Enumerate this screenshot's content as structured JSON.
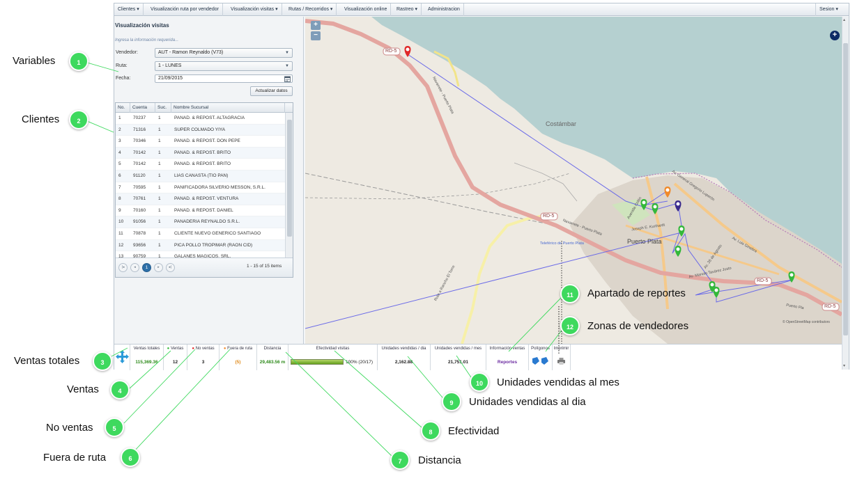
{
  "menu": {
    "items": [
      {
        "label": "Clientes",
        "caret": "▾"
      },
      {
        "label": "Visualización ruta por vendedor",
        "caret": ""
      },
      {
        "label": "Visualización visitas",
        "caret": "▾"
      },
      {
        "label": "Rutas / Recorridos",
        "caret": "▾"
      },
      {
        "label": "Visualización online",
        "caret": ""
      },
      {
        "label": "Rastreo",
        "caret": "▾"
      },
      {
        "label": "Administracion",
        "caret": ""
      }
    ],
    "session": "Sesion",
    "session_caret": "▾"
  },
  "panel": {
    "title": "Visualización visitas",
    "hint": "Ingresa la información requerida...",
    "vendedor_label": "Vendedor:",
    "vendedor_value": "AUT - Ramon Reynaldo (V73)",
    "ruta_label": "Ruta:",
    "ruta_value": "1 - LUNES",
    "fecha_label": "Fecha:",
    "fecha_value": "21/09/2015",
    "update_button": "Actualizar datos"
  },
  "grid": {
    "headers": [
      "No.",
      "Cuenta",
      "Suc.",
      "Nombre Sucursal"
    ],
    "rows": [
      [
        "1",
        "70237",
        "1",
        "PANAD. & REPOST. ALTAGRACIA"
      ],
      [
        "2",
        "71316",
        "1",
        "SUPER COLMADO YIYA"
      ],
      [
        "3",
        "70346",
        "1",
        "PANAD. & REPOST. DON PEPE"
      ],
      [
        "4",
        "70142",
        "1",
        "PANAD. & REPOST. BRITO"
      ],
      [
        "5",
        "70142",
        "1",
        "PANAD. & REPOST. BRITO"
      ],
      [
        "6",
        "91120",
        "1",
        "LIAS CANASTA (TIO PAN)"
      ],
      [
        "7",
        "70595",
        "1",
        "PANIFICADORA SILVERIO MESSON, S.R.L."
      ],
      [
        "8",
        "70761",
        "1",
        "PANAD. & REPOST. VENTURA"
      ],
      [
        "9",
        "70160",
        "1",
        "PANAD. & REPOST. DANIEL"
      ],
      [
        "10",
        "91056",
        "1",
        "PANADERIA REYNALDO S.R.L."
      ],
      [
        "11",
        "70878",
        "1",
        "CLIENTE NUEVO GENERICO SANTIAGO"
      ],
      [
        "12",
        "93656",
        "1",
        "PICA POLLO TROPIMAR (RAON CID)"
      ],
      [
        "13",
        "90759",
        "1",
        "GALANES MAGICOS, SRL."
      ]
    ],
    "pager_buttons": [
      "|◂",
      "◂",
      "1",
      "▸",
      "▸|"
    ],
    "page_info": "1 - 15 of 15 items"
  },
  "map": {
    "zoom_in": "+",
    "zoom_out": "−",
    "layers_button": "+",
    "labels": {
      "costambar": "Costámbar",
      "puerto_plata": "Puerto Plata",
      "rd5_a": "RD-5",
      "rd5_b": "RD-5",
      "rd5_c": "RD-5",
      "rd5_d": "RD-5",
      "telefonico": "Teleférico de Puerto Plata",
      "nav_puerto": "Navarrete - Puerto Plata",
      "nav_puerto_2": "Navarrete - Puerto Plata",
      "ruta_torre": "Ruta a Rancho El Torre",
      "av_colon": "Avenida Colón",
      "av_gregorio": "Av. General Gregorio Luperón",
      "av_manolo": "Av. Manolo Tavárez Justo",
      "av_luis": "Av. Luis Ginebra",
      "joseph": "Joseph E. Kunhardt",
      "av_25": "Av. 26 de Agosto",
      "puerto_pla": "Puerto Pla",
      "attribution": "© OpenStreetMap contributors"
    },
    "colors": {
      "sea": "#b5d0d0",
      "land": "#eeeae2",
      "urban": "#d9d2c8",
      "primary_road": "#e4a6a0",
      "secondary_road": "#f7f0a8",
      "route_line": "#6a6ae8",
      "venta_pin": "#33b83a",
      "no_venta_pin": "#e02828",
      "fuera_ruta_pin": "#f08a2a",
      "current_pin": "#3a2a8c"
    }
  },
  "stats": {
    "ventas_totales_label": "Ventas totales",
    "ventas_totales_value": "115,369.36",
    "ventas_label": "Ventas",
    "ventas_value": "12",
    "no_ventas_label": "No ventas",
    "no_ventas_value": "3",
    "fuera_ruta_label": "Fuera de ruta",
    "fuera_ruta_value": "(5)",
    "distancia_label": "Distancia",
    "distancia_value": "29,483.56 m",
    "efectividad_label": "Efectividad visitas",
    "efectividad_value": "100% (20/17)",
    "efectividad_fraction": 1.0,
    "u_dia_label": "Unidades vendidas / dia",
    "u_dia_value": "2,162.88",
    "u_mes_label": "Unidades vendidas / mes",
    "u_mes_value": "21,751.01",
    "info_label": "Información ventas",
    "reportes_link": "Reportes",
    "poligonos_label": "Polígonos",
    "imprimir_label": "Imprimir"
  },
  "callouts": [
    {
      "n": "1",
      "label": "Variables"
    },
    {
      "n": "2",
      "label": "Clientes"
    },
    {
      "n": "3",
      "label": "Ventas totales"
    },
    {
      "n": "4",
      "label": "Ventas"
    },
    {
      "n": "5",
      "label": "No ventas"
    },
    {
      "n": "6",
      "label": "Fuera de ruta"
    },
    {
      "n": "7",
      "label": "Distancia"
    },
    {
      "n": "8",
      "label": "Efectividad"
    },
    {
      "n": "9",
      "label": "Unidades vendidas al dia"
    },
    {
      "n": "10",
      "label": "Unidades vendidas al mes"
    },
    {
      "n": "11",
      "label": "Apartado de reportes"
    },
    {
      "n": "12",
      "label": "Zonas de vendedores"
    }
  ],
  "colors": {
    "badge": "#3ed95e",
    "leader": "#3ed95e",
    "ventas_totales_text": "#2d8a1a",
    "reportes_text": "#6b2aa0",
    "fuera_ruta_text": "#e08a1a"
  }
}
